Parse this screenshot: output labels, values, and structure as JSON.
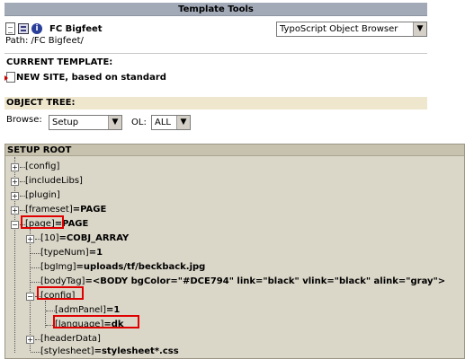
{
  "header": {
    "title": "Template Tools"
  },
  "site": {
    "name": "FC Bigfeet",
    "path": "Path: /FC Bigfeet/"
  },
  "function_menu": {
    "selected": "TypoScript Object Browser"
  },
  "current_template": {
    "label": "CURRENT TEMPLATE:",
    "name": "NEW SITE, based on standard"
  },
  "object_tree": {
    "label": "OBJECT TREE:",
    "browse_label": "Browse:",
    "browse_value": "Setup",
    "ol_label": "OL:",
    "ol_value": "ALL"
  },
  "tree": {
    "root": "SETUP ROOT",
    "nodes": [
      {
        "key": "[config]",
        "value": ""
      },
      {
        "key": "[includeLibs]",
        "value": ""
      },
      {
        "key": "[plugin]",
        "value": ""
      },
      {
        "key": "[frameset]",
        "value": "=PAGE"
      },
      {
        "key": "[page]",
        "value": "=PAGE"
      },
      {
        "key": "[10]",
        "value": "=COBJ_ARRAY"
      },
      {
        "key": "[typeNum]",
        "value": "=1"
      },
      {
        "key": "[bgImg]",
        "value": "=uploads/tf/beckback.jpg"
      },
      {
        "key": "[bodyTag]",
        "value": "=<BODY bgColor=\"#DCE794\" link=\"black\" vlink=\"black\" alink=\"gray\">"
      },
      {
        "key": "[config]",
        "value": ""
      },
      {
        "key": "[admPanel]",
        "value": "=1"
      },
      {
        "key": "[language]",
        "value": "=dk"
      },
      {
        "key": "[headerData]",
        "value": ""
      },
      {
        "key": "[stylesheet]",
        "value": "=stylesheet*.css"
      }
    ]
  }
}
